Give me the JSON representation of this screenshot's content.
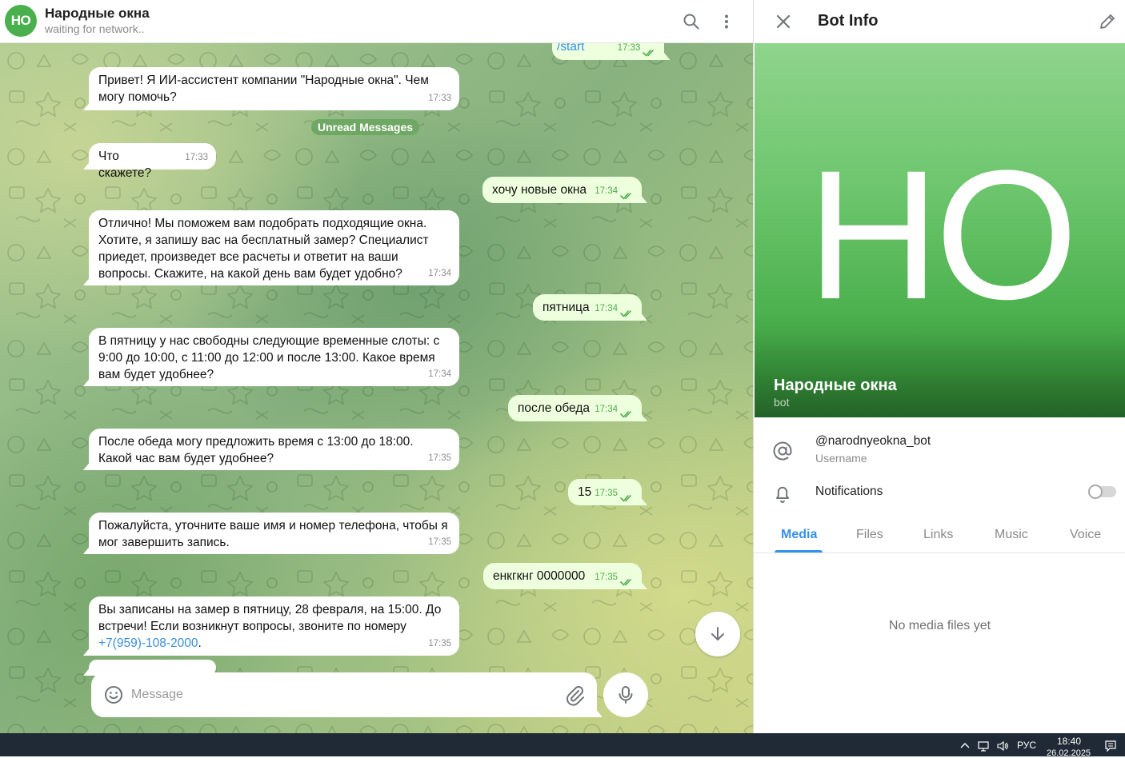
{
  "chat": {
    "avatar_initials": "НО",
    "title": "Народные окна",
    "status": "waiting for network..",
    "unread_label": "Unread Messages",
    "messages": [
      {
        "dir": "out",
        "text": "/start",
        "time": "17:33"
      },
      {
        "dir": "in",
        "text": "Привет! Я ИИ-ассистент компании \"Народные окна\". Чем могу помочь?",
        "time": "17:33"
      },
      {
        "dir": "in",
        "text": "Что скажете?",
        "time": "17:33"
      },
      {
        "dir": "out",
        "text": "хочу новые окна",
        "time": "17:34"
      },
      {
        "dir": "in",
        "text": "Отлично! Мы поможем вам подобрать подходящие окна. Хотите, я запишу вас на бесплатный замер? Специалист приедет, произведет все расчеты и ответит на ваши вопросы. Скажите, на какой день вам будет удобно?",
        "time": "17:34"
      },
      {
        "dir": "out",
        "text": "пятница",
        "time": "17:34"
      },
      {
        "dir": "in",
        "text": "В пятницу у нас свободны следующие временные слоты: с 9:00 до 10:00, с 11:00 до 12:00 и после 13:00. Какое время вам будет удобнее?",
        "time": "17:34"
      },
      {
        "dir": "out",
        "text": "после обеда",
        "time": "17:34"
      },
      {
        "dir": "in",
        "text": "После обеда могу предложить время с 13:00 до 18:00. Какой час вам будет удобнее?",
        "time": "17:35"
      },
      {
        "dir": "out",
        "text": "15",
        "time": "17:35"
      },
      {
        "dir": "in",
        "text": "Пожалуйста, уточните ваше имя и номер телефона, чтобы я мог завершить запись.",
        "time": "17:35"
      },
      {
        "dir": "out",
        "text": "енкгкнг 0000000",
        "time": "17:35"
      },
      {
        "dir": "in",
        "text": "Вы записаны на замер в пятницу, 28 февраля, на 15:00. До встречи! Если возникнут вопросы, звоните по номеру",
        "link": "+7(959)-108-2000",
        "suffix": ".",
        "time": "17:35"
      }
    ],
    "composer": {
      "placeholder": "Message"
    }
  },
  "info": {
    "title": "Bot Info",
    "hero": {
      "initials": "НО",
      "name": "Народные окна",
      "subtitle": "bot"
    },
    "username": {
      "value": "@narodnyeokna_bot",
      "label": "Username"
    },
    "notifications": {
      "label": "Notifications",
      "enabled": false
    },
    "tabs": [
      "Media",
      "Files",
      "Links",
      "Music",
      "Voice"
    ],
    "active_tab": "Media",
    "empty_text": "No media files yet"
  },
  "taskbar": {
    "lang": "РУС",
    "time": "18:40",
    "date": "26.02.2025"
  },
  "colors": {
    "accent": "#3390ec",
    "avatar": "#49b04d",
    "outgoing_bubble": "#eeffde",
    "taskbar": "#202a36"
  }
}
